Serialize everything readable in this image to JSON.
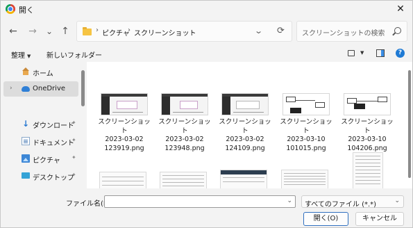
{
  "window": {
    "title": "開く"
  },
  "nav": {
    "back": "←",
    "forward": "→",
    "recent": "⌄",
    "up": "↑",
    "breadcrumbs": [
      "ピクチャ",
      "スクリーンショット"
    ],
    "separator": "›",
    "refresh": "⟳",
    "dropdown": "⌄"
  },
  "search": {
    "placeholder": "スクリーンショットの検索"
  },
  "toolbar": {
    "organize": "整理",
    "organize_caret": "▼",
    "new_folder": "新しいフォルダー",
    "view_caret": "▼",
    "help": "?"
  },
  "sidebar": {
    "items": [
      {
        "label": "ホーム",
        "icon": "home-icon"
      },
      {
        "label": "OneDrive",
        "icon": "onedrive-icon",
        "expander": "›",
        "selected": true
      },
      {
        "label": "ダウンロード",
        "icon": "download-icon",
        "pin": "📌"
      },
      {
        "label": "ドキュメント",
        "icon": "documents-icon",
        "pin": "📌"
      },
      {
        "label": "ピクチャ",
        "icon": "pictures-icon",
        "pin": "📌"
      },
      {
        "label": "デスクトップ",
        "icon": "desktop-icon",
        "pin": "📌"
      }
    ]
  },
  "files": [
    {
      "line1": "スクリーンショット",
      "line2": "2023-03-02",
      "line3": "123919.png"
    },
    {
      "line1": "スクリーンショット",
      "line2": "2023-03-02",
      "line3": "123948.png"
    },
    {
      "line1": "スクリーンショット",
      "line2": "2023-03-02",
      "line3": "124109.png"
    },
    {
      "line1": "スクリーンショット",
      "line2": "2023-03-10",
      "line3": "101015.png"
    },
    {
      "line1": "スクリーンショット",
      "line2": "2023-03-10",
      "line3": "104206.png"
    }
  ],
  "bottom": {
    "filename_label": "ファイル名(N):",
    "filename_value": "",
    "filetype": "すべてのファイル (*.*)",
    "open_button": "開く(O)",
    "cancel_button": "キャンセル"
  }
}
